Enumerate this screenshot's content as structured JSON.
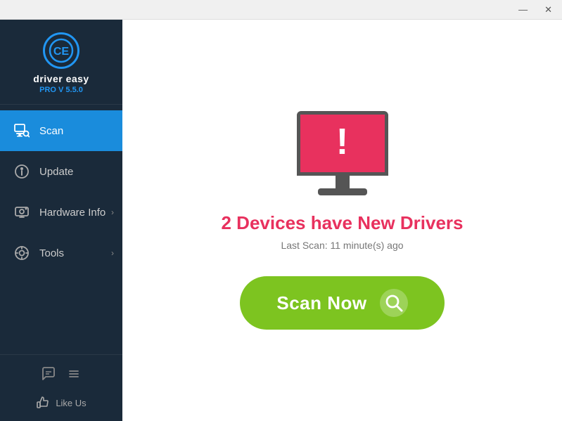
{
  "titleBar": {
    "minimize": "—",
    "close": "✕"
  },
  "brand": {
    "name": "driver easy",
    "version": "PRO V 5.5.0",
    "logoText": "CE"
  },
  "sidebar": {
    "items": [
      {
        "id": "scan",
        "label": "Scan",
        "active": true,
        "hasChevron": false
      },
      {
        "id": "update",
        "label": "Update",
        "active": false,
        "hasChevron": false
      },
      {
        "id": "hardware-info",
        "label": "Hardware Info",
        "active": false,
        "hasChevron": true
      },
      {
        "id": "tools",
        "label": "Tools",
        "active": false,
        "hasChevron": true
      }
    ],
    "footer": {
      "likeUs": "Like Us"
    }
  },
  "main": {
    "headline": "2 Devices have New Drivers",
    "subtitle": "Last Scan: 11 minute(s) ago",
    "scanButton": "Scan Now"
  },
  "colors": {
    "accent": "#e8315e",
    "brand": "#1a8cdc",
    "buttonGreen": "#7dc420"
  }
}
